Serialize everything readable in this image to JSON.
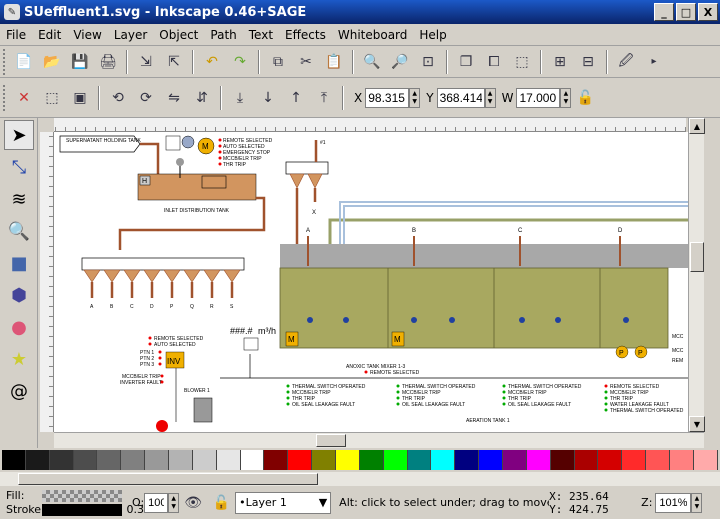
{
  "window": {
    "title": "SUeffluent1.svg - Inkscape 0.46+SAGE",
    "min_label": "_",
    "max_label": "□",
    "close_label": "X"
  },
  "menu": [
    "File",
    "Edit",
    "View",
    "Layer",
    "Object",
    "Path",
    "Text",
    "Effects",
    "Whiteboard",
    "Help"
  ],
  "toolbar_coords": {
    "x_label": "X",
    "x_value": "98.315",
    "y_label": "Y",
    "y_value": "368.414",
    "w_label": "W",
    "w_value": "17.000"
  },
  "canvas": {
    "supernatant": "SUPERNATANT HOLDING TANK",
    "inlet": "INLET DISTRIBUTION TANK",
    "h_label": "H",
    "m_label": "M",
    "inlet_status": [
      "REMOTE SELECTED",
      "AUTO SELECTED",
      "EMERGENCY STOP",
      "MCCB/ELR TRIP",
      "THR TRIP"
    ],
    "distribution": [
      "A",
      "B",
      "C",
      "D",
      "P",
      "Q",
      "R",
      "S"
    ],
    "channels": [
      "A",
      "B",
      "C",
      "D"
    ],
    "hash_label": "###.#",
    "flow_unit": "m³/h",
    "inv_label": "INV",
    "ptn": [
      "PTN 1",
      "PTN 2",
      "PTN 3"
    ],
    "inv_status": [
      "MCCB/ELR TRIP",
      "INVERTER FAULT"
    ],
    "blower_status": [
      "REMOTE SELECTED",
      "AUTO SELECTED"
    ],
    "blower": "BLOWER 1",
    "x_label": "X",
    "feed_label": "#1",
    "anoxic": "ANOXIC TANK MIXER 1-3",
    "anoxic_sub": "REMOTE SELECTED",
    "status_block": [
      "THERMAL SWITCH OPERATED",
      "MCCB/ELR TRIP",
      "THR TRIP",
      "OIL SEAL LEAKAGE FAULT"
    ],
    "right_status": [
      "REMOTE SELECTED",
      "MCCB/ELR TRIP",
      "THR TRIP",
      "WATER LEAKAGE FAULT",
      "THERMAL SWITCH OPERATED"
    ],
    "aeration": "AERATION TANK 1",
    "p_label": "P",
    "m_edge": [
      "MCC",
      "MCC",
      "REM"
    ]
  },
  "status": {
    "fill_label": "Fill:",
    "stroke_label": "Stroke:",
    "stroke_width": "0.3",
    "o_label": "O:",
    "o_value": "100",
    "layer": "•Layer 1",
    "message": "Alt: click to select under; drag to move selected",
    "x_label": "X:",
    "x_value": "235.64",
    "y_label": "Y:",
    "y_value": "424.75",
    "z_label": "Z:",
    "zoom": "101%"
  },
  "palette": [
    "#000000",
    "#1a1a1a",
    "#333333",
    "#4d4d4d",
    "#666666",
    "#808080",
    "#999999",
    "#b3b3b3",
    "#cccccc",
    "#e6e6e6",
    "#ffffff",
    "#800000",
    "#ff0000",
    "#808000",
    "#ffff00",
    "#008000",
    "#00ff00",
    "#008080",
    "#00ffff",
    "#000080",
    "#0000ff",
    "#800080",
    "#ff00ff",
    "#550000",
    "#aa0000",
    "#d40000",
    "#ff2a2a",
    "#ff5555",
    "#ff8080",
    "#ffaaaa"
  ]
}
